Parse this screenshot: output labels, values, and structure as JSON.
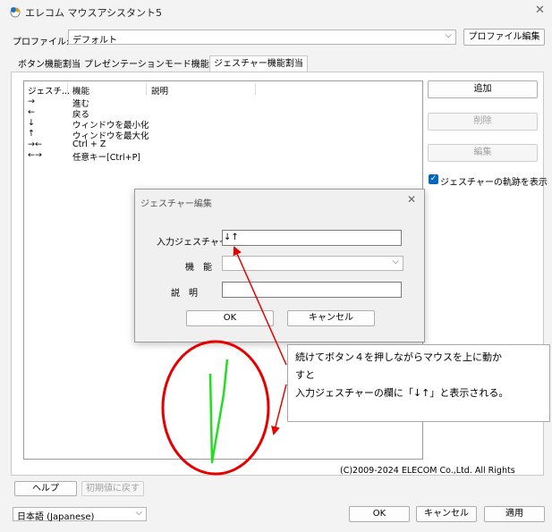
{
  "window": {
    "title": "エレコム マウスアシスタント5",
    "close_glyph": "✕"
  },
  "profile": {
    "label": "プロファイル:",
    "value": "デフォルト",
    "edit_button": "プロファイル編集"
  },
  "tabs": [
    {
      "label": "ボタン機能割当"
    },
    {
      "label": "プレゼンテーションモード機能割当"
    },
    {
      "label": "ジェスチャー機能割当",
      "active": true
    }
  ],
  "gesture_list": {
    "headers": [
      "ジェスチ...",
      "機能",
      "説明"
    ],
    "rows": [
      {
        "gesture": "→",
        "function": "進む",
        "description": ""
      },
      {
        "gesture": "←",
        "function": "戻る",
        "description": ""
      },
      {
        "gesture": "↓",
        "function": "ウィンドウを最小化",
        "description": ""
      },
      {
        "gesture": "↑",
        "function": "ウィンドウを最大化",
        "description": ""
      },
      {
        "gesture": "→←",
        "function": "Ctrl + Z",
        "description": ""
      },
      {
        "gesture": "←→",
        "function": "任意キー[Ctrl+P]",
        "description": ""
      }
    ]
  },
  "side_buttons": {
    "add": "追加",
    "delete": "削除",
    "edit": "編集"
  },
  "show_trail": {
    "label": "ジェスチャーの軌跡を表示",
    "checked": true
  },
  "dialog": {
    "title": "ジェスチャー編集",
    "input_gesture_label": "入力ジェスチャー",
    "input_gesture_value": "↓↑",
    "function_label": "機　能",
    "function_value": "",
    "description_label": "説　明",
    "description_value": "",
    "ok": "OK",
    "cancel": "キャンセル"
  },
  "callout": {
    "line1": "続けてボタン４を押しながらマウスを上に動か",
    "line2": "すと",
    "line3": "入力ジェスチャーの欄に「↓↑」と表示される。"
  },
  "copyright": "(C)2009-2024 ELECOM Co.,Ltd. All Rights",
  "bottom": {
    "help": "ヘルプ",
    "reset": "初期値に戻す",
    "language": "日本語 (Japanese)",
    "ok": "OK",
    "cancel": "キャンセル",
    "apply": "適用"
  },
  "colors": {
    "annotation_red": "#e60000",
    "trail_green": "#22dd22",
    "accent_blue": "#0067c0"
  }
}
